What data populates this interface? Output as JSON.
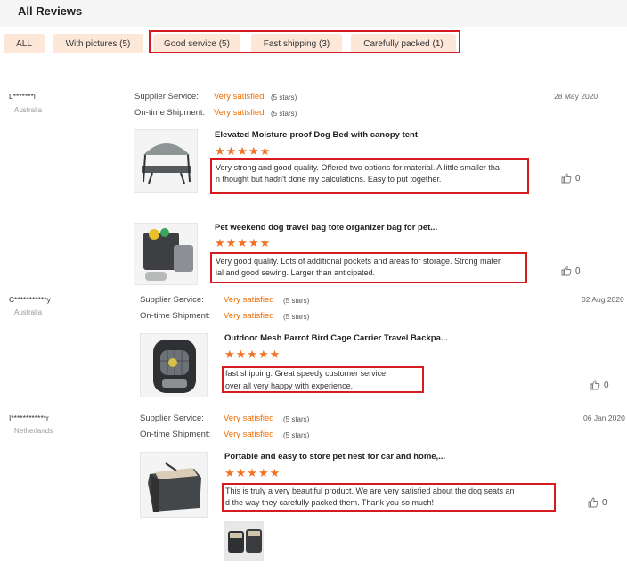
{
  "header": {
    "title": "All Reviews"
  },
  "filters": [
    {
      "label": "ALL"
    },
    {
      "label": "With pictures (5)"
    },
    {
      "label": "Good service (5)"
    },
    {
      "label": "Fast shipping (3)"
    },
    {
      "label": "Carefully packed (1)"
    }
  ],
  "reviews": [
    {
      "user": "L*******l",
      "country": "Australia",
      "date": "28 May 2020",
      "supplier_label": "Supplier Service:",
      "supplier_value": "Very satisfied",
      "supplier_stars": "(5 stars)",
      "shipment_label": "On-time Shipment:",
      "shipment_value": "Very satisfied",
      "shipment_stars": "(5 stars)",
      "product": "Elevated Moisture-proof Dog Bed with canopy tent",
      "text_line1": "Very strong and good quality.  Offered two options for material. A little smaller tha",
      "text_line2": "n thought but hadn't done my calculations.  Easy to put together.",
      "likes": "0"
    },
    {
      "product": "Pet weekend dog travel bag tote organizer bag for pet...",
      "text_line1": "Very good quality.  Lots of additional pockets and areas for storage.  Strong mater",
      "text_line2": "ial and good sewing.  Larger than anticipated.",
      "likes": "0"
    },
    {
      "user": "C***********y",
      "country": "Australia",
      "date": "02 Aug 2020",
      "supplier_label": "Supplier Service:",
      "supplier_value": "Very satisfied",
      "supplier_stars": "(5 stars)",
      "shipment_label": "On-time Shipment:",
      "shipment_value": "Very satisfied",
      "shipment_stars": "(5 stars)",
      "product": "Outdoor Mesh Parrot Bird Cage Carrier Travel Backpa...",
      "text_line1": "fast shipping. Great speedy customer service.",
      "text_line2": "over all very happy with experience.",
      "likes": "0"
    },
    {
      "user": "I************r",
      "country": "Netherlands",
      "date": "06 Jan 2020",
      "supplier_label": "Supplier Service:",
      "supplier_value": "Very satisfied",
      "supplier_stars": "(5 stars)",
      "shipment_label": "On-time Shipment:",
      "shipment_value": "Very satisfied",
      "shipment_stars": "(5 stars)",
      "product": "Portable and easy to store pet nest for car and home,...",
      "text_line1": "This is truly a very beautiful product. We are very satisfied about the dog seats an",
      "text_line2": "d the way they carefully packed them. Thank you so much!",
      "likes": "0"
    }
  ],
  "star_glyphs": "★★★★★",
  "colors": {
    "accent": "#f37021",
    "chip_bg": "#fde7d9",
    "highlight": "#d71920"
  }
}
